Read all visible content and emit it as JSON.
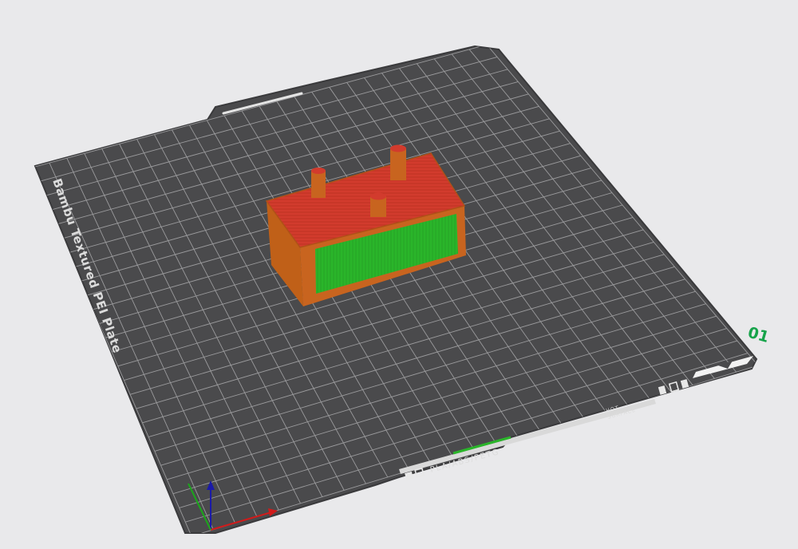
{
  "plate": {
    "brand_label": "Bambu Textured PEI Plate",
    "plate_number": "01",
    "material_label": "PLA/ABS/PETG",
    "hot_surface_line1": "HOT",
    "hot_surface_line2": "SURFACE"
  },
  "colors": {
    "background": "#e9e9eb",
    "plate": "#4a4a4c",
    "plate_edge": "#3a3a3c",
    "grid_line": "#9b9b9d",
    "plate_number": "#16a34a",
    "model_top": "#d23b2d",
    "model_body": "#c8641f",
    "model_face": "#2ab52a"
  },
  "icons": {
    "axis_gizmo": "xyz-axes-icon",
    "plate_status": "plate-status-icon",
    "plate_handle": "plate-handle-icon"
  }
}
